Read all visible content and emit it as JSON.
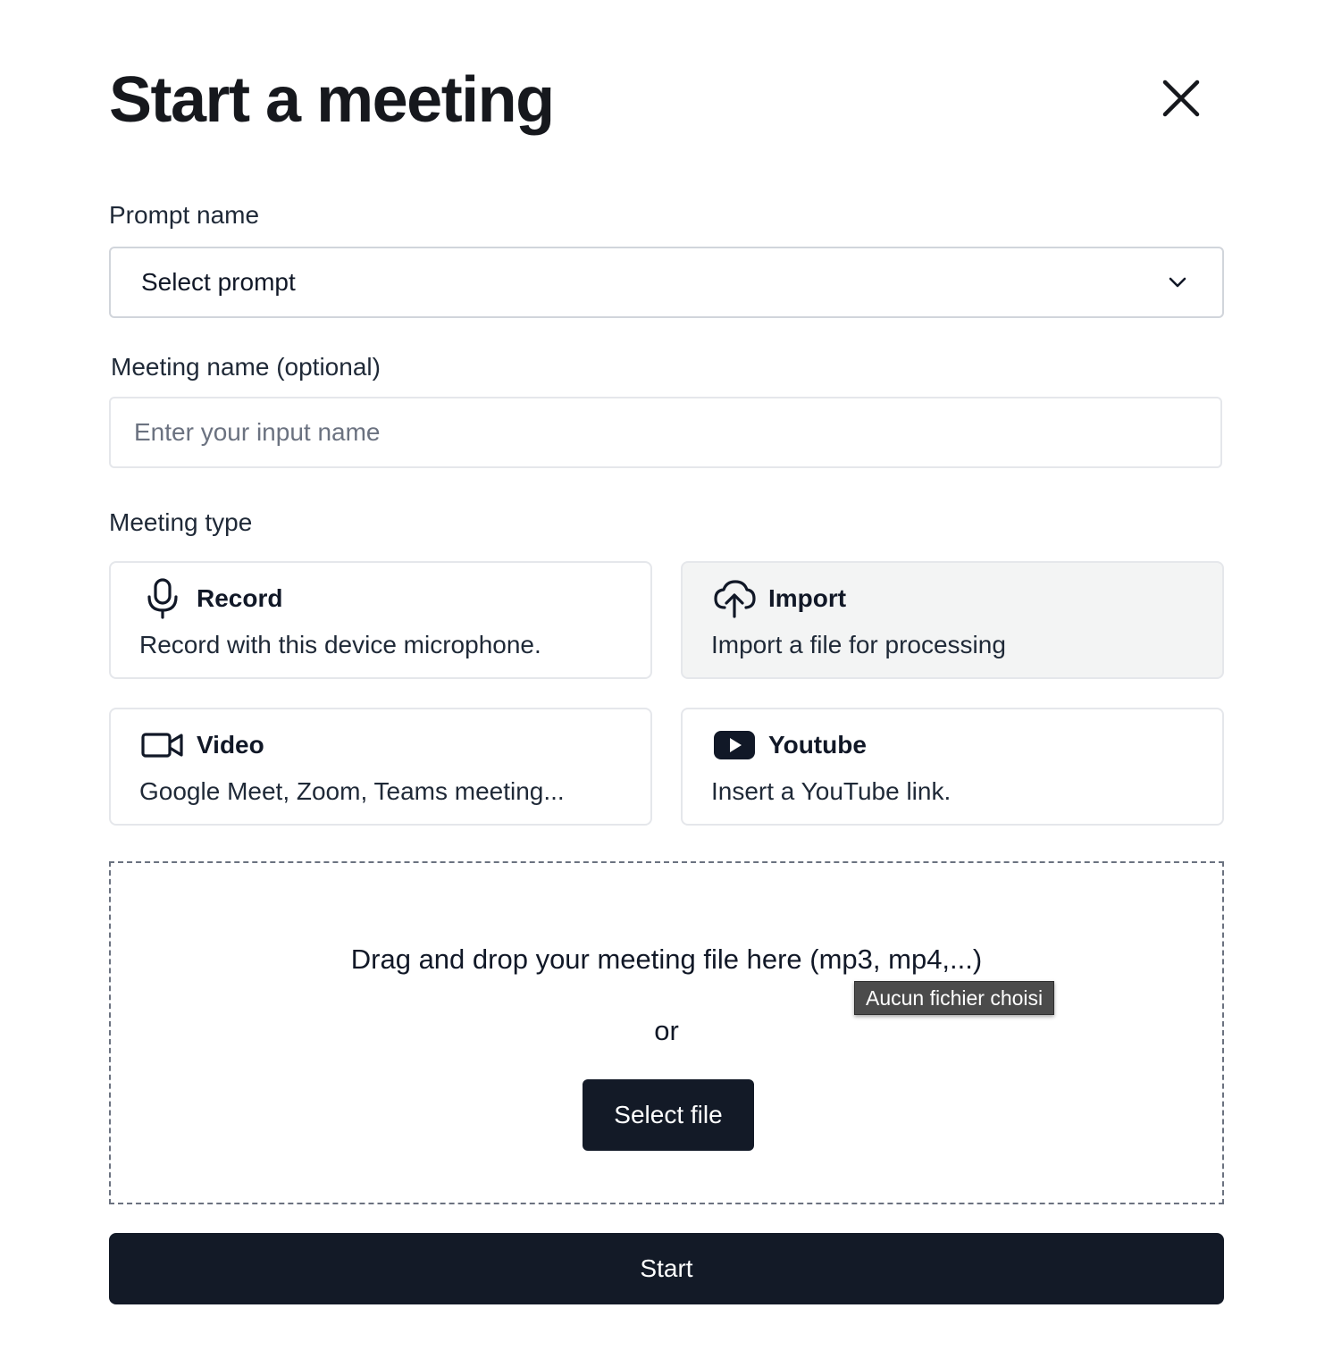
{
  "modal": {
    "title": "Start a meeting",
    "close_icon": "close-icon"
  },
  "prompt": {
    "label": "Prompt name",
    "selected": "Select prompt",
    "icon": "chevron-down-icon"
  },
  "meeting_name": {
    "label": "Meeting name (optional)",
    "placeholder": "Enter your input name",
    "value": ""
  },
  "meeting_type": {
    "label": "Meeting type",
    "selected": "import",
    "options": [
      {
        "id": "record",
        "title": "Record",
        "description": "Record with this device microphone.",
        "icon": "microphone-icon"
      },
      {
        "id": "import",
        "title": "Import",
        "description": "Import a file for processing",
        "icon": "cloud-upload-icon"
      },
      {
        "id": "video",
        "title": "Video",
        "description": "Google Meet, Zoom, Teams meeting...",
        "icon": "video-camera-icon"
      },
      {
        "id": "youtube",
        "title": "Youtube",
        "description": "Insert a YouTube link.",
        "icon": "youtube-icon"
      }
    ]
  },
  "dropzone": {
    "text": "Drag and drop your meeting file here (mp3, mp4,...)",
    "or": "or",
    "button_label": "Select file",
    "tooltip": "Aucun fichier choisi"
  },
  "actions": {
    "start_label": "Start"
  },
  "colors": {
    "primary_button": "#131a27",
    "selected_card_bg": "#f3f4f4",
    "border": "#e5e7eb"
  }
}
